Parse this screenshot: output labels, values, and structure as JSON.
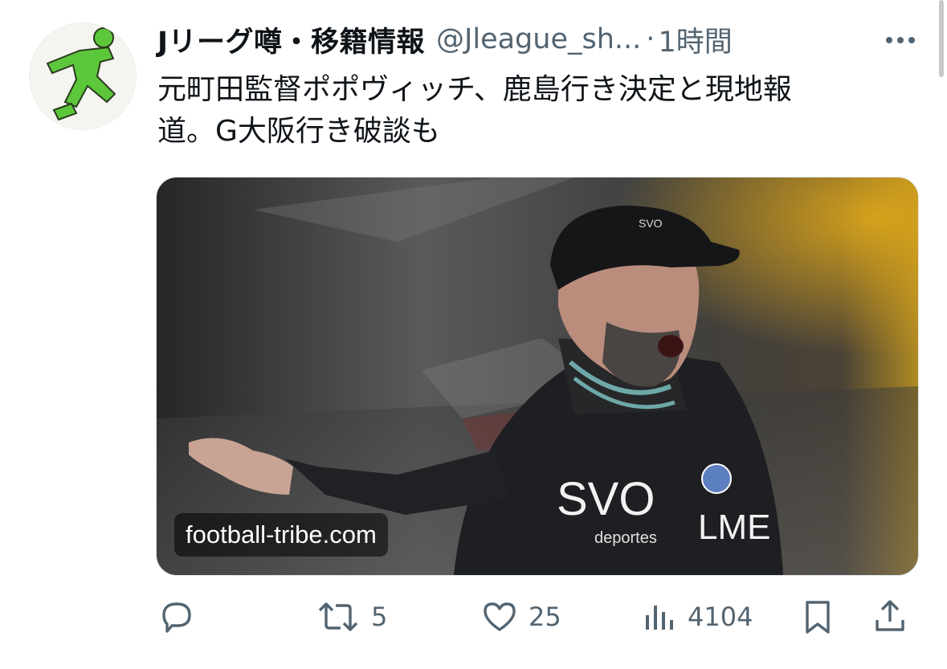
{
  "tweet": {
    "author_name": "Jリーグ噂・移籍情報",
    "handle": "@Jleague_sh...",
    "separator": "·",
    "time": "1時間",
    "text_line1": "元町田監督ポポヴィッチ、鹿島行き決定と現地報",
    "text_line2": "道。G大阪行き破談も",
    "media": {
      "link_domain": "football-tribe.com",
      "jacket_text": "SVO",
      "jacket_text2": "LME",
      "jacket_small": "deportes"
    },
    "actions": {
      "reply": {
        "icon": "reply-icon",
        "count": ""
      },
      "retweet": {
        "icon": "retweet-icon",
        "count": "5"
      },
      "like": {
        "icon": "heart-icon",
        "count": "25"
      },
      "views": {
        "icon": "views-icon",
        "count": "4104"
      },
      "bookmark": {
        "icon": "bookmark-icon"
      },
      "share": {
        "icon": "share-icon"
      }
    }
  },
  "colors": {
    "text": "#0f1419",
    "secondary": "#536471",
    "avatar_green": "#5cc73a"
  }
}
